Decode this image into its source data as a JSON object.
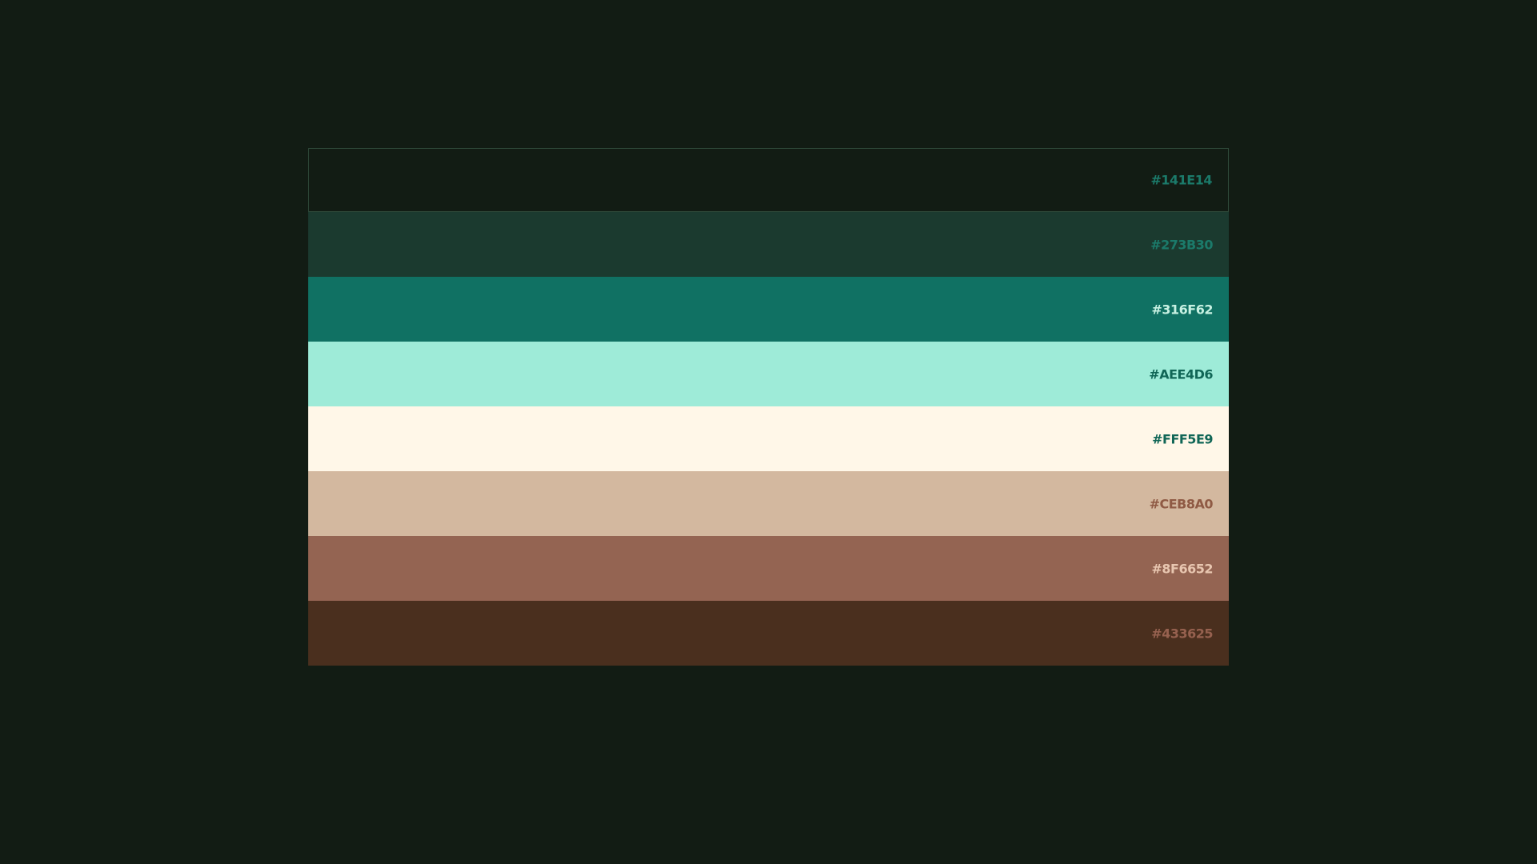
{
  "palette": {
    "swatches": [
      {
        "hex_label": "#141E14",
        "fill": "#121c14",
        "label_color": "#1b7a6a"
      },
      {
        "hex_label": "#273B30",
        "fill": "#1b3a2f",
        "label_color": "#1b7a6a"
      },
      {
        "hex_label": "#316F62",
        "fill": "#107163",
        "label_color": "#c7f1e2"
      },
      {
        "hex_label": "#AEE4D6",
        "fill": "#9eebd8",
        "label_color": "#106656"
      },
      {
        "hex_label": "#FFF5E9",
        "fill": "#fff7e8",
        "label_color": "#106656"
      },
      {
        "hex_label": "#CEB8A0",
        "fill": "#d3b89f",
        "label_color": "#8f5a44"
      },
      {
        "hex_label": "#8F6652",
        "fill": "#946452",
        "label_color": "#e8c6b0"
      },
      {
        "hex_label": "#433625",
        "fill": "#4a2f1e",
        "label_color": "#96614f"
      }
    ]
  }
}
